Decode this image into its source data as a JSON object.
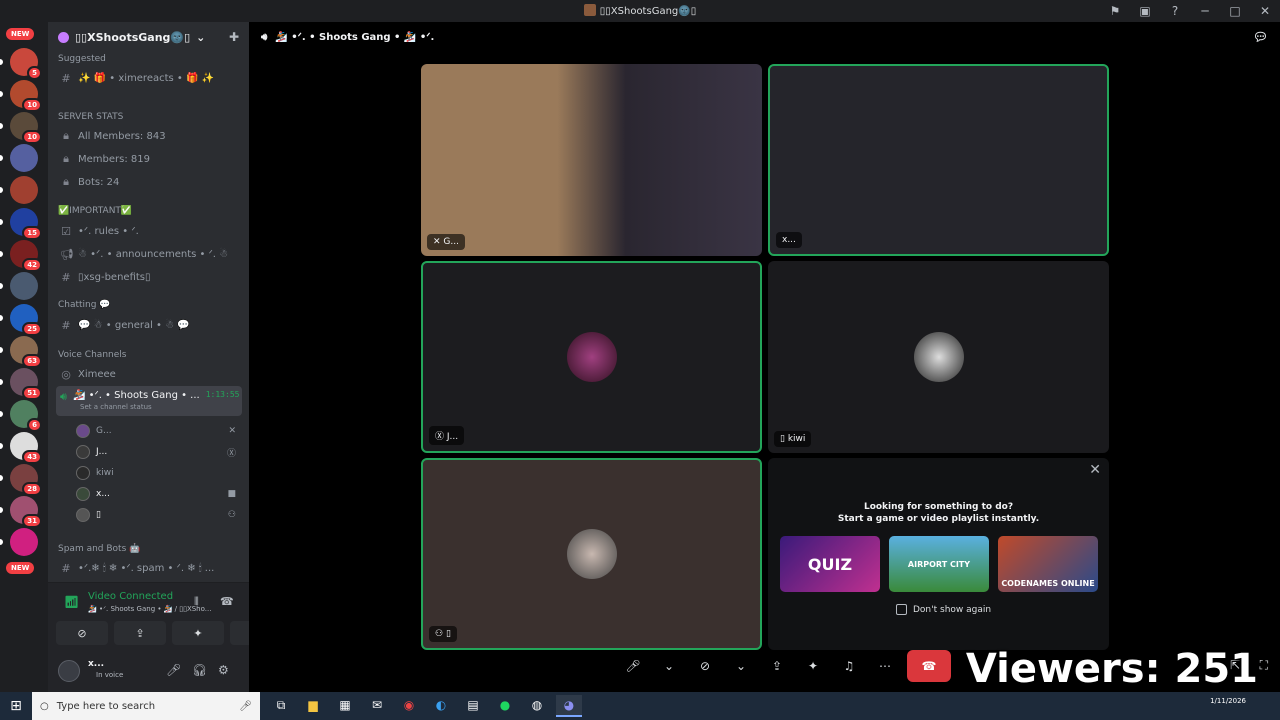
{
  "window": {
    "title": "▯▯XShootsGang🌚▯"
  },
  "rail": {
    "new_label": "NEW",
    "servers": [
      {
        "badge": "5",
        "color": "#c9483c"
      },
      {
        "badge": "10",
        "color": "#b24a2e"
      },
      {
        "badge": "10",
        "color": "#5a4a3a"
      },
      {
        "badge": "",
        "color": "#5560a0"
      },
      {
        "badge": "",
        "color": "#a04030"
      },
      {
        "badge": "15",
        "color": "#2040a0"
      },
      {
        "badge": "42",
        "color": "#7a2020"
      },
      {
        "badge": "",
        "color": "#4a5a70"
      },
      {
        "badge": "25",
        "color": "#2060c0"
      },
      {
        "badge": "63",
        "color": "#8a6a50"
      },
      {
        "badge": "51",
        "color": "#6a5060"
      },
      {
        "badge": "6",
        "color": "#508060"
      },
      {
        "badge": "43",
        "color": "#ddd"
      },
      {
        "badge": "28",
        "color": "#7a4040"
      },
      {
        "badge": "31",
        "color": "#a05070"
      },
      {
        "badge": "",
        "color": "#d02080"
      }
    ]
  },
  "sidebar": {
    "server_name": "▯▯XShootsGang🌚▯",
    "suggested_label": "Suggested",
    "suggested_channel": "✨ 🎁 • ximereacts • 🎁 ✨",
    "stats_cat": "SERVER STATS",
    "stats": [
      "All Members: 843",
      "Members: 819",
      "Bots: 24"
    ],
    "important_cat": "✅IMPORTANT✅",
    "important": [
      "•ᐟ. rules • ᐟ.",
      "☃ •ᐟ. • announcements • ᐟ. ☃",
      "▯xsg-benefits▯"
    ],
    "chatting_cat": "Chatting 💬",
    "chatting": [
      "💬 ☃ • general • ☃ 💬"
    ],
    "voice_cat": "Voice Channels",
    "voice_channels": [
      "Ximeee",
      "🏂 •ᐟ. • Shoots Gang • ..."
    ],
    "active_time": "1:13:55",
    "channel_status": "Set a channel status",
    "users": [
      {
        "name": "G...",
        "right": "✕"
      },
      {
        "name": "J...",
        "right": "Ⓧ"
      },
      {
        "name": "kiwi",
        "right": ""
      },
      {
        "name": "x...",
        "right": "■"
      },
      {
        "name": "▯",
        "right": "⚇"
      }
    ],
    "spam_cat": "Spam and Bots 🤖",
    "spam_channel": "•ᐟ.❄ 🕯 ❄ •ᐟ. spam • ᐟ. ❄ 🕯 ..."
  },
  "voice_panel": {
    "status": "Video Connected",
    "location": "🏂 •ᐟ. Shoots Gang • 🏂 / ▯▯XSho..."
  },
  "user_bar": {
    "name": "x...",
    "status": "In voice"
  },
  "stage": {
    "channel": "🏂 •ᐟ. • Shoots Gang • 🏂 •ᐟ.",
    "tiles": [
      {
        "name": "G...",
        "icon": "✕"
      },
      {
        "name": "x...",
        "icon": ""
      },
      {
        "name": "J...",
        "icon": "Ⓧ"
      },
      {
        "name": "kiwi",
        "icon": "▯"
      },
      {
        "name": "▯",
        "icon": "⚇"
      }
    ],
    "promo": {
      "line1": "Looking for something to do?",
      "line2": "Start a game or video playlist instantly.",
      "cards": [
        "QUIZ",
        "AIRPORT CITY",
        "CODENAMES ONLINE"
      ],
      "checkbox": "Don't show again"
    },
    "overlay": "Viewers: 251"
  },
  "taskbar": {
    "search_placeholder": "Type here to search",
    "date": "1/11/2026"
  }
}
